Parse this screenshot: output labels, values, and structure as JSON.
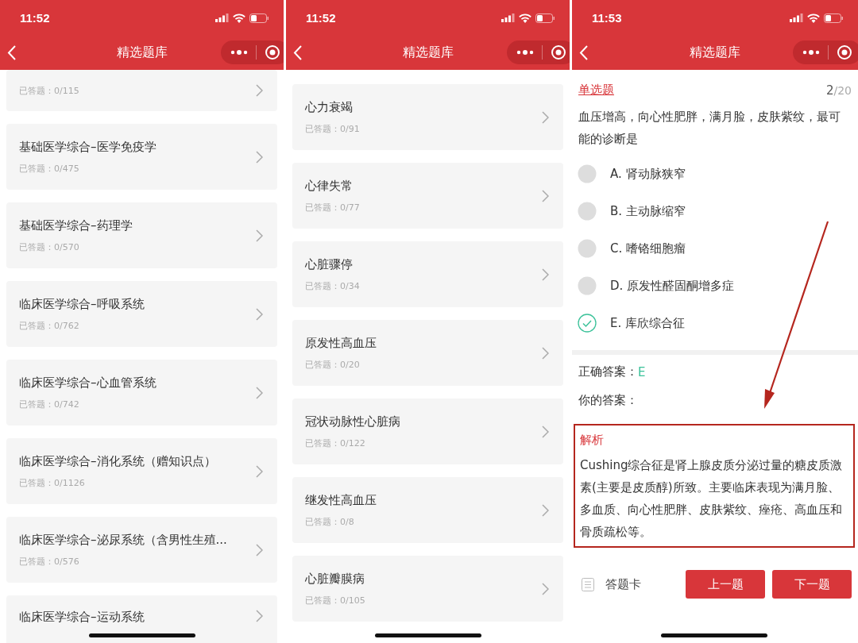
{
  "screens": [
    {
      "kind": "list",
      "status_time": "11:52",
      "title": "精选题库",
      "items": [
        {
          "count": "已答题：0/115"
        },
        {
          "title": "基础医学综合–医学免疫学",
          "count": "已答题：0/475"
        },
        {
          "title": "基础医学综合–药理学",
          "count": "已答题：0/570"
        },
        {
          "title": "临床医学综合–呼吸系统",
          "count": "已答题：0/762"
        },
        {
          "title": "临床医学综合–心血管系统",
          "count": "已答题：0/742"
        },
        {
          "title": "临床医学综合–消化系统（赠知识点）",
          "count": "已答题：0/1126"
        },
        {
          "title": "临床医学综合–泌尿系统（含男性生殖...",
          "count": "已答题：0/576"
        },
        {
          "title": "临床医学综合–运动系统"
        }
      ]
    },
    {
      "kind": "list",
      "status_time": "11:52",
      "title": "精选题库",
      "items": [
        {
          "title": "心力衰竭",
          "count": "已答题：0/91"
        },
        {
          "title": "心律失常",
          "count": "已答题：0/77"
        },
        {
          "title": "心脏骤停",
          "count": "已答题：0/34"
        },
        {
          "title": "原发性高血压",
          "count": "已答题：0/20"
        },
        {
          "title": "冠状动脉性心脏病",
          "count": "已答题：0/122"
        },
        {
          "title": "继发性高血压",
          "count": "已答题：0/8"
        },
        {
          "title": "心脏瓣膜病",
          "count": "已答题：0/105"
        }
      ]
    },
    {
      "kind": "question",
      "status_time": "11:53",
      "title": "精选题库",
      "question_type": "单选题",
      "progress_current": "2",
      "progress_total": "/20",
      "question": "血压增高，向心性肥胖，满月脸，皮肤紫纹，最可能的诊断是",
      "options": [
        {
          "label": "A. 肾动脉狭窄",
          "selected": false
        },
        {
          "label": "B. 主动脉缩窄",
          "selected": false
        },
        {
          "label": "C. 嗜铬细胞瘤",
          "selected": false
        },
        {
          "label": "D. 原发性醛固酮增多症",
          "selected": false
        },
        {
          "label": "E. 库欣综合征",
          "selected": true
        }
      ],
      "correct_answer_label": "正确答案：",
      "correct_answer": "E",
      "your_answer_label": "你的答案：",
      "analysis_title": "解析",
      "analysis": "Cushing综合征是肾上腺皮质分泌过量的糖皮质激素(主要是皮质醇)所致。主要临床表现为满月脸、多血质、向心性肥胖、皮肤紫纹、痤疮、高血压和骨质疏松等。",
      "answer_card": "答题卡",
      "buttons": [
        "上一题",
        "下一题"
      ]
    }
  ]
}
